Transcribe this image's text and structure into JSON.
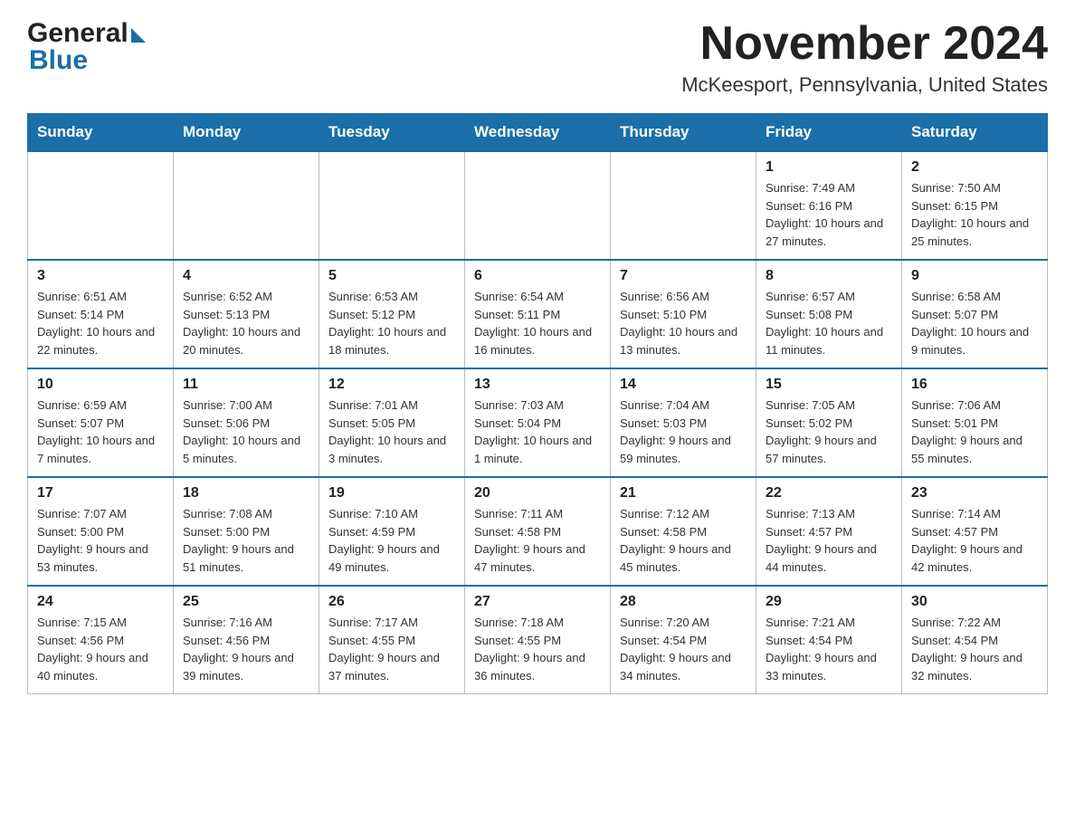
{
  "header": {
    "month_title": "November 2024",
    "location": "McKeesport, Pennsylvania, United States",
    "logo_general": "General",
    "logo_blue": "Blue"
  },
  "calendar": {
    "days_of_week": [
      "Sunday",
      "Monday",
      "Tuesday",
      "Wednesday",
      "Thursday",
      "Friday",
      "Saturday"
    ],
    "weeks": [
      {
        "days": [
          {
            "number": "",
            "info": ""
          },
          {
            "number": "",
            "info": ""
          },
          {
            "number": "",
            "info": ""
          },
          {
            "number": "",
            "info": ""
          },
          {
            "number": "",
            "info": ""
          },
          {
            "number": "1",
            "info": "Sunrise: 7:49 AM\nSunset: 6:16 PM\nDaylight: 10 hours and 27 minutes."
          },
          {
            "number": "2",
            "info": "Sunrise: 7:50 AM\nSunset: 6:15 PM\nDaylight: 10 hours and 25 minutes."
          }
        ]
      },
      {
        "days": [
          {
            "number": "3",
            "info": "Sunrise: 6:51 AM\nSunset: 5:14 PM\nDaylight: 10 hours and 22 minutes."
          },
          {
            "number": "4",
            "info": "Sunrise: 6:52 AM\nSunset: 5:13 PM\nDaylight: 10 hours and 20 minutes."
          },
          {
            "number": "5",
            "info": "Sunrise: 6:53 AM\nSunset: 5:12 PM\nDaylight: 10 hours and 18 minutes."
          },
          {
            "number": "6",
            "info": "Sunrise: 6:54 AM\nSunset: 5:11 PM\nDaylight: 10 hours and 16 minutes."
          },
          {
            "number": "7",
            "info": "Sunrise: 6:56 AM\nSunset: 5:10 PM\nDaylight: 10 hours and 13 minutes."
          },
          {
            "number": "8",
            "info": "Sunrise: 6:57 AM\nSunset: 5:08 PM\nDaylight: 10 hours and 11 minutes."
          },
          {
            "number": "9",
            "info": "Sunrise: 6:58 AM\nSunset: 5:07 PM\nDaylight: 10 hours and 9 minutes."
          }
        ]
      },
      {
        "days": [
          {
            "number": "10",
            "info": "Sunrise: 6:59 AM\nSunset: 5:07 PM\nDaylight: 10 hours and 7 minutes."
          },
          {
            "number": "11",
            "info": "Sunrise: 7:00 AM\nSunset: 5:06 PM\nDaylight: 10 hours and 5 minutes."
          },
          {
            "number": "12",
            "info": "Sunrise: 7:01 AM\nSunset: 5:05 PM\nDaylight: 10 hours and 3 minutes."
          },
          {
            "number": "13",
            "info": "Sunrise: 7:03 AM\nSunset: 5:04 PM\nDaylight: 10 hours and 1 minute."
          },
          {
            "number": "14",
            "info": "Sunrise: 7:04 AM\nSunset: 5:03 PM\nDaylight: 9 hours and 59 minutes."
          },
          {
            "number": "15",
            "info": "Sunrise: 7:05 AM\nSunset: 5:02 PM\nDaylight: 9 hours and 57 minutes."
          },
          {
            "number": "16",
            "info": "Sunrise: 7:06 AM\nSunset: 5:01 PM\nDaylight: 9 hours and 55 minutes."
          }
        ]
      },
      {
        "days": [
          {
            "number": "17",
            "info": "Sunrise: 7:07 AM\nSunset: 5:00 PM\nDaylight: 9 hours and 53 minutes."
          },
          {
            "number": "18",
            "info": "Sunrise: 7:08 AM\nSunset: 5:00 PM\nDaylight: 9 hours and 51 minutes."
          },
          {
            "number": "19",
            "info": "Sunrise: 7:10 AM\nSunset: 4:59 PM\nDaylight: 9 hours and 49 minutes."
          },
          {
            "number": "20",
            "info": "Sunrise: 7:11 AM\nSunset: 4:58 PM\nDaylight: 9 hours and 47 minutes."
          },
          {
            "number": "21",
            "info": "Sunrise: 7:12 AM\nSunset: 4:58 PM\nDaylight: 9 hours and 45 minutes."
          },
          {
            "number": "22",
            "info": "Sunrise: 7:13 AM\nSunset: 4:57 PM\nDaylight: 9 hours and 44 minutes."
          },
          {
            "number": "23",
            "info": "Sunrise: 7:14 AM\nSunset: 4:57 PM\nDaylight: 9 hours and 42 minutes."
          }
        ]
      },
      {
        "days": [
          {
            "number": "24",
            "info": "Sunrise: 7:15 AM\nSunset: 4:56 PM\nDaylight: 9 hours and 40 minutes."
          },
          {
            "number": "25",
            "info": "Sunrise: 7:16 AM\nSunset: 4:56 PM\nDaylight: 9 hours and 39 minutes."
          },
          {
            "number": "26",
            "info": "Sunrise: 7:17 AM\nSunset: 4:55 PM\nDaylight: 9 hours and 37 minutes."
          },
          {
            "number": "27",
            "info": "Sunrise: 7:18 AM\nSunset: 4:55 PM\nDaylight: 9 hours and 36 minutes."
          },
          {
            "number": "28",
            "info": "Sunrise: 7:20 AM\nSunset: 4:54 PM\nDaylight: 9 hours and 34 minutes."
          },
          {
            "number": "29",
            "info": "Sunrise: 7:21 AM\nSunset: 4:54 PM\nDaylight: 9 hours and 33 minutes."
          },
          {
            "number": "30",
            "info": "Sunrise: 7:22 AM\nSunset: 4:54 PM\nDaylight: 9 hours and 32 minutes."
          }
        ]
      }
    ]
  }
}
